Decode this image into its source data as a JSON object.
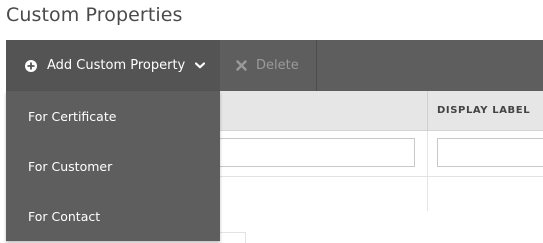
{
  "page": {
    "title": "Custom Properties"
  },
  "toolbar": {
    "add_label": "Add Custom Property",
    "delete_label": "Delete",
    "add_icon": "plus-circle-icon",
    "delete_icon": "x-icon",
    "dropdown_icon": "chevron-down-icon"
  },
  "dropdown": {
    "items": [
      {
        "label": "For Certificate"
      },
      {
        "label": "For Customer"
      },
      {
        "label": "For Contact"
      }
    ]
  },
  "grid": {
    "columns": [
      {
        "label": ""
      },
      {
        "label": "DISPLAY LABEL"
      }
    ],
    "filter_row": {
      "name_value": "",
      "display_value": ""
    }
  },
  "colors": {
    "toolbar": "#5e5e5e",
    "toolbar_active": "#545454",
    "header_bg": "#e6e6e6",
    "disabled_text": "#9a9a9a"
  }
}
